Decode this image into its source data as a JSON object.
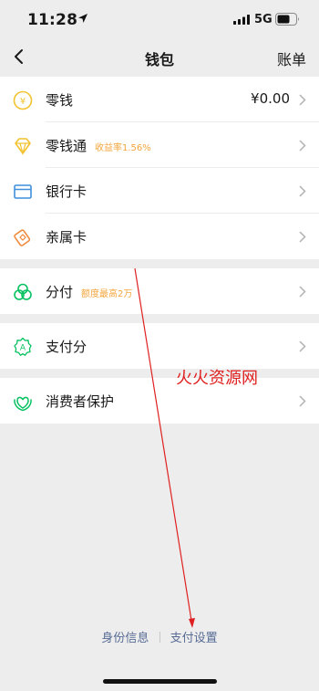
{
  "status_bar": {
    "time": "11:28",
    "network": "5G"
  },
  "nav": {
    "title": "钱包",
    "right": "账单"
  },
  "groups": [
    {
      "items": [
        {
          "label": "零钱",
          "value": "¥0.00",
          "icon": "coin-icon"
        },
        {
          "label": "零钱通",
          "badge": "收益率1.56%",
          "icon": "diamond-icon"
        },
        {
          "label": "银行卡",
          "icon": "bank-card-icon"
        },
        {
          "label": "亲属卡",
          "icon": "family-card-icon"
        }
      ]
    },
    {
      "items": [
        {
          "label": "分付",
          "badge": "额度最高2万",
          "icon": "fenfu-icon"
        }
      ]
    },
    {
      "items": [
        {
          "label": "支付分",
          "icon": "pay-score-icon"
        }
      ]
    },
    {
      "items": [
        {
          "label": "消费者保护",
          "icon": "consumer-protection-icon"
        }
      ]
    }
  ],
  "watermark": "火火资源网",
  "footer": {
    "identity_info": "身份信息",
    "payment_settings": "支付设置"
  },
  "colors": {
    "background": "#ededed",
    "accent_orange": "#f3a53b",
    "link_blue": "#576b95",
    "green": "#07c160",
    "annotation_red": "#e02020"
  }
}
